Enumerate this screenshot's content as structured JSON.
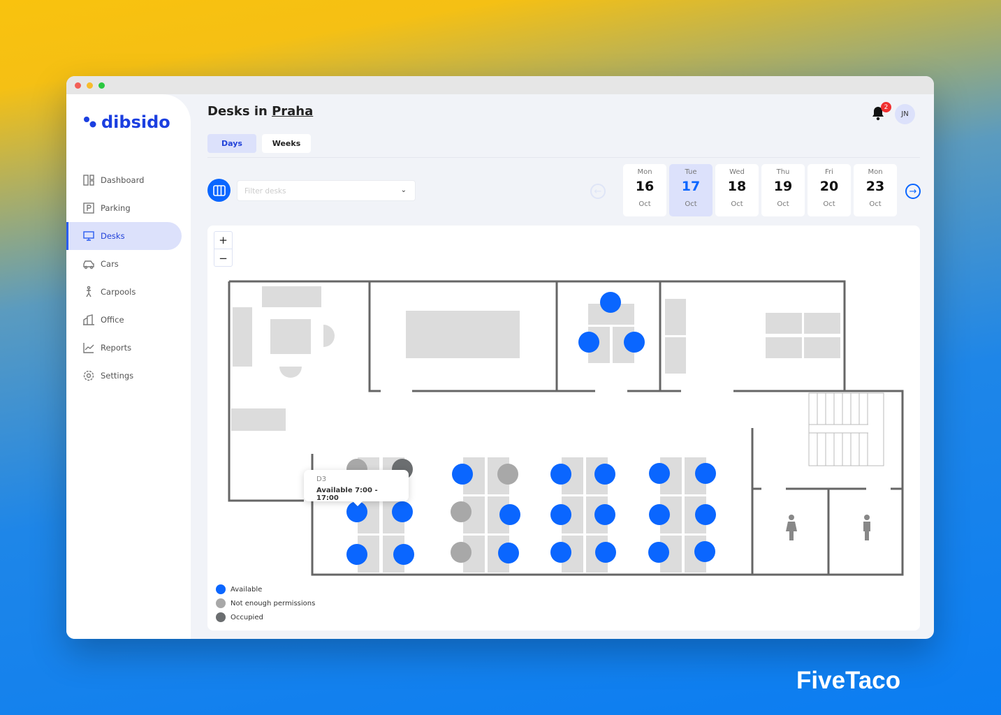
{
  "app": {
    "logo": "dibsido",
    "brand_color": "#1b3fe0",
    "accent": "#0a66ff"
  },
  "sidebar": {
    "items": [
      {
        "label": "Dashboard",
        "icon": "dashboard-icon"
      },
      {
        "label": "Parking",
        "icon": "parking-icon"
      },
      {
        "label": "Desks",
        "icon": "desk-monitor-icon",
        "active": true
      },
      {
        "label": "Cars",
        "icon": "car-icon"
      },
      {
        "label": "Carpools",
        "icon": "carpool-icon"
      },
      {
        "label": "Office",
        "icon": "office-icon"
      },
      {
        "label": "Reports",
        "icon": "reports-icon"
      },
      {
        "label": "Settings",
        "icon": "settings-icon"
      }
    ]
  },
  "header": {
    "title_prefix": "Desks in",
    "location": "Praha",
    "notifications": "2",
    "avatar": "JN"
  },
  "tabs": [
    {
      "label": "Days",
      "active": true
    },
    {
      "label": "Weeks"
    }
  ],
  "filter": {
    "placeholder": "Filter desks"
  },
  "days": [
    {
      "name": "Mon",
      "date": "16",
      "month": "Oct"
    },
    {
      "name": "Tue",
      "date": "17",
      "month": "Oct",
      "selected": true
    },
    {
      "name": "Wed",
      "date": "18",
      "month": "Oct"
    },
    {
      "name": "Thu",
      "date": "19",
      "month": "Oct"
    },
    {
      "name": "Fri",
      "date": "20",
      "month": "Oct"
    },
    {
      "name": "Mon",
      "date": "23",
      "month": "Oct"
    }
  ],
  "zoom": {
    "in": "+",
    "out": "−"
  },
  "tooltip": {
    "desk": "D3",
    "text": "Available 7:00 - 17:00"
  },
  "status_colors": {
    "available": "#0a66ff",
    "no_permission": "#a8a8a8",
    "occupied": "#6b6e70"
  },
  "legend": [
    {
      "label": "Available",
      "status": "available"
    },
    {
      "label": "Not enough permissions",
      "status": "no_permission"
    },
    {
      "label": "Occupied",
      "status": "occupied"
    }
  ],
  "desks": [
    "no_permission",
    "occupied",
    "available",
    "available",
    "available",
    "available",
    "available",
    "no_permission",
    "no_permission",
    "available",
    "no_permission",
    "available",
    "available",
    "available",
    "available",
    "available",
    "available",
    "available",
    "available",
    "available",
    "available",
    "available",
    "available",
    "available",
    "available",
    "available",
    "available"
  ],
  "watermark": "FiveTaco"
}
